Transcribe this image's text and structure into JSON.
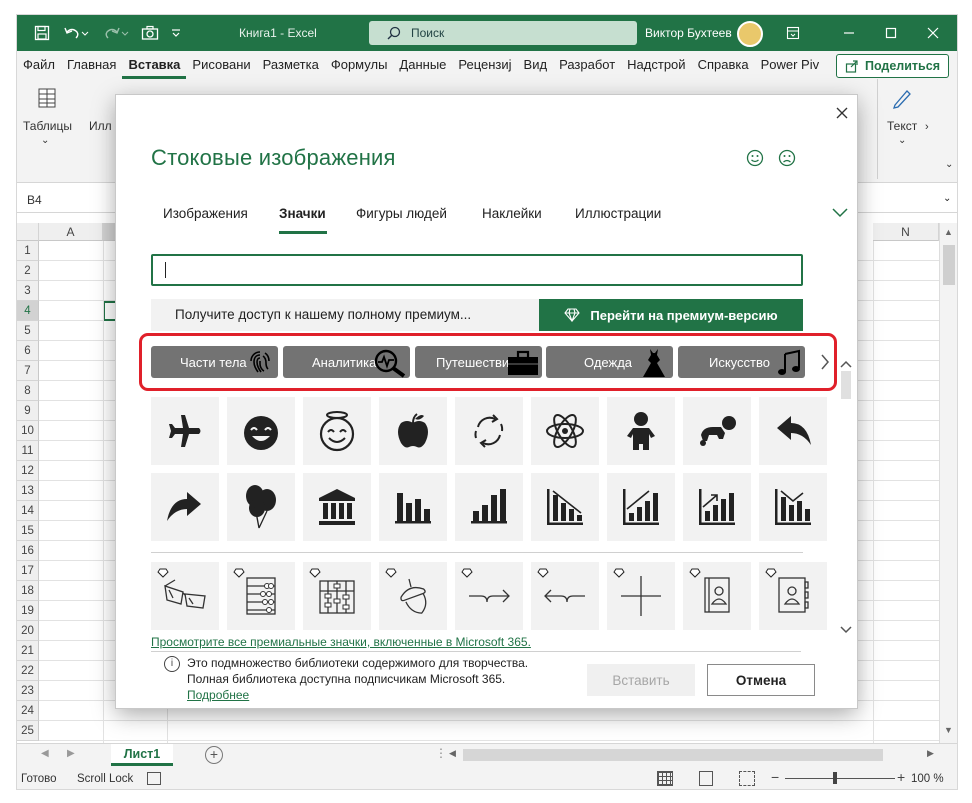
{
  "titlebar": {
    "title": "Книга1 - Excel",
    "search_placeholder": "Поиск",
    "user_name": "Виктор Бухтеев",
    "accent": "#217346"
  },
  "menu": {
    "tabs": [
      "Файл",
      "Главная",
      "Вставка",
      "Рисовани",
      "Разметка",
      "Формулы",
      "Данные",
      "Рецензиј",
      "Вид",
      "Разработ",
      "Надстрой",
      "Справка",
      "Power Piv"
    ],
    "active": "Вставка",
    "share_label": "Поделиться"
  },
  "ribbon": {
    "tables_label": "Таблицы",
    "illustrations_label": "Илл",
    "text_label": "Текст"
  },
  "formula": {
    "name_box": "B4"
  },
  "sheet": {
    "columns": [
      "A",
      "N"
    ],
    "rows": [
      "1",
      "2",
      "3",
      "4",
      "5",
      "6",
      "7",
      "8",
      "9",
      "10",
      "11",
      "12",
      "13",
      "14",
      "15",
      "16",
      "17",
      "18",
      "19",
      "20",
      "21",
      "22",
      "23",
      "24",
      "25"
    ],
    "tab_label": "Лист1"
  },
  "status": {
    "ready": "Готово",
    "scroll_lock": "Scroll Lock",
    "zoom": "100 %"
  },
  "dialog": {
    "title": "Стоковые изображения",
    "tabs": [
      "Изображения",
      "Значки",
      "Фигуры людей",
      "Наклейки",
      "Иллюстрации"
    ],
    "active_tab": "Значки",
    "search_value": "",
    "premium_text": "Получите доступ к нашему полному премиум...",
    "premium_button": "Перейти на премиум-версию",
    "categories": [
      "Части тела",
      "Аналитика",
      "Путешествие",
      "Одежда",
      "Искусство"
    ],
    "icons_row1": [
      "airplane-icon",
      "smiley-icon",
      "angel-smiley-icon",
      "apple-icon",
      "refresh-cycle-icon",
      "atom-icon",
      "baby-icon",
      "crawling-baby-icon",
      "reply-arrow-icon"
    ],
    "icons_row2": [
      "forward-arrow-icon",
      "balloons-icon",
      "bank-icon",
      "bar-chart-icon",
      "bar-chart-baseline-icon",
      "bar-chart-down-icon",
      "bar-chart-up-icon",
      "bar-chart-arrow-icon",
      "bar-chart-trend-icon"
    ],
    "icons_row3_premium": [
      "3d-glasses-icon",
      "abacus-icon",
      "abacus-frame-icon",
      "acorn-icon",
      "arrow-curve-right-icon",
      "arrow-curve-left-icon",
      "crosshair-icon",
      "address-book-icon",
      "contact-book-icon"
    ],
    "premium_link": "Просмотрите все премиальные значки, включенные в Microsoft 365.",
    "footer_line1": "Это подмножество библиотеки содержимого для творчества.",
    "footer_line2": "Полная библиотека доступна подписчикам Microsoft 365.",
    "footer_link": "Подробнее",
    "insert_label": "Вставить",
    "cancel_label": "Отмена"
  }
}
